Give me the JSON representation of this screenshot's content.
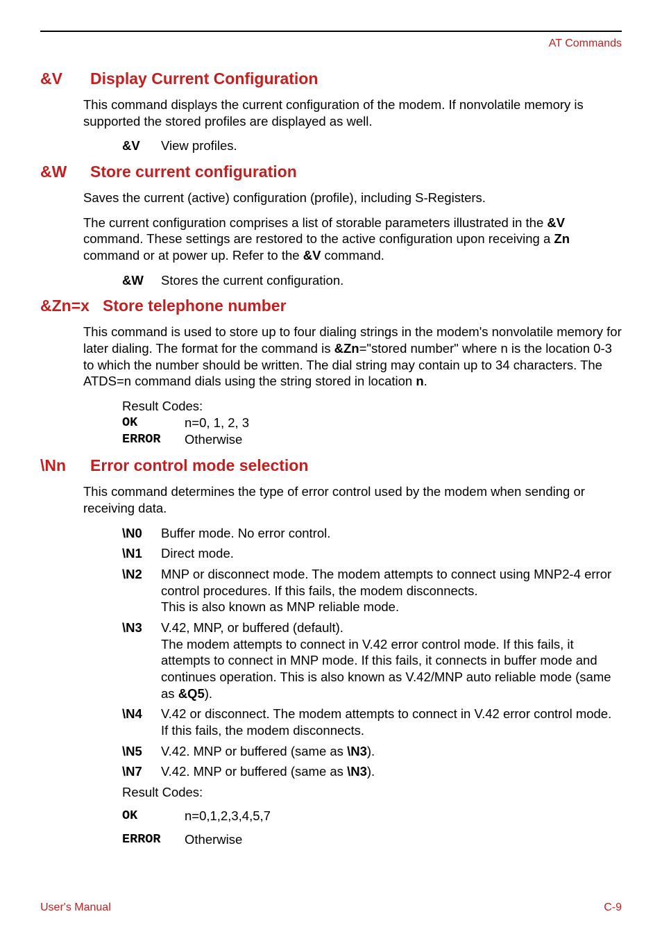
{
  "header": {
    "right": "AT Commands"
  },
  "sections": {
    "v": {
      "code": "&V",
      "title": "Display Current Configuration",
      "para1": "This command displays the current configuration of the modem. If nonvolatile memory is supported the stored profiles are displayed as well.",
      "defs": [
        {
          "label": "&V",
          "desc": "View profiles."
        }
      ]
    },
    "w": {
      "code": "&W",
      "title": "Store current configuration",
      "para1": "Saves the current (active) configuration (profile), including S-Registers.",
      "para2_pre": "The current configuration comprises a list of storable parameters illustrated in the ",
      "para2_b1": "&V",
      "para2_mid1": " command. These settings are restored to the active configuration upon receiving a ",
      "para2_b2": "Zn",
      "para2_mid2": " command or at power up. Refer to the ",
      "para2_b3": "&V",
      "para2_post": " command.",
      "defs": [
        {
          "label": "&W",
          "desc": "Stores the current configuration."
        }
      ]
    },
    "z": {
      "code": "&Zn=x",
      "title": "Store telephone number",
      "para1_pre": "This command is used to store up to four dialing strings in the modem's nonvolatile memory for later dialing. The format for the command is ",
      "para1_b1": "&Zn",
      "para1_mid1": "=\"stored number\" where n is the location 0-3 to which the number should be written. The dial string may contain up to 34 characters. The ATDS=n command dials using the string stored in location ",
      "para1_b2": "n",
      "para1_post": ".",
      "results_label": "Result Codes:",
      "results": [
        {
          "code": "OK",
          "desc": "n=0, 1, 2, 3"
        },
        {
          "code": "ERROR",
          "desc": "Otherwise"
        }
      ]
    },
    "n": {
      "code": "\\Nn",
      "title": "Error control mode selection",
      "para1": "This command determines the type of error control used by the modem when sending or receiving data.",
      "defs": {
        "n0": {
          "label": "\\N0",
          "desc": "Buffer mode. No error control."
        },
        "n1": {
          "label": "\\N1",
          "desc": "Direct mode."
        },
        "n2": {
          "label": "\\N2",
          "desc1": "MNP or disconnect mode. The modem attempts to connect using MNP2-4 error control procedures. If this fails, the modem disconnects.",
          "desc2": "This is also known as MNP reliable mode."
        },
        "n3": {
          "label": "\\N3",
          "desc1": "V.42, MNP, or buffered (default).",
          "desc2_pre": "The modem attempts to connect in V.42 error control mode. If this fails, it attempts to connect in MNP mode. If this fails, it connects in buffer mode and continues operation. This is also known as V.42/MNP auto reliable mode (same as ",
          "desc2_b": "&Q5",
          "desc2_post": ")."
        },
        "n4": {
          "label": "\\N4",
          "desc": "V.42 or disconnect. The modem attempts to connect in V.42 error control mode. If this fails, the modem disconnects."
        },
        "n5": {
          "label": "\\N5",
          "desc_pre": "V.42. MNP or buffered (same as ",
          "desc_b": "\\N3",
          "desc_post": ")."
        },
        "n7": {
          "label": "\\N7",
          "desc_pre": "V.42. MNP or buffered (same as ",
          "desc_b": "\\N3",
          "desc_post": ")."
        }
      },
      "results_label": "Result Codes:",
      "results": [
        {
          "code": "OK",
          "desc": "n=0,1,2,3,4,5,7"
        },
        {
          "code": "ERROR",
          "desc": "Otherwise"
        }
      ]
    }
  },
  "footer": {
    "left": "User's Manual",
    "right": "C-9"
  }
}
